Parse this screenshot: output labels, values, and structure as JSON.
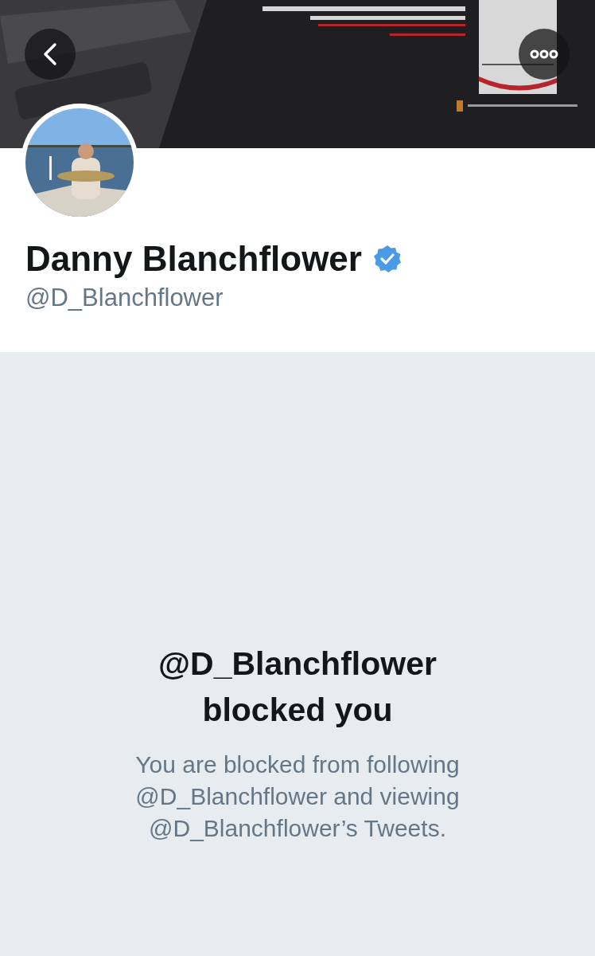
{
  "profile": {
    "name": "Danny Blanchflower",
    "verified": true,
    "handle": "@D_Blanchflower"
  },
  "blocked": {
    "title": "@D_Blanchflower blocked you",
    "message": "You are blocked from following @D_Blanchflower and viewing @D_Blanchflower’s Tweets."
  }
}
